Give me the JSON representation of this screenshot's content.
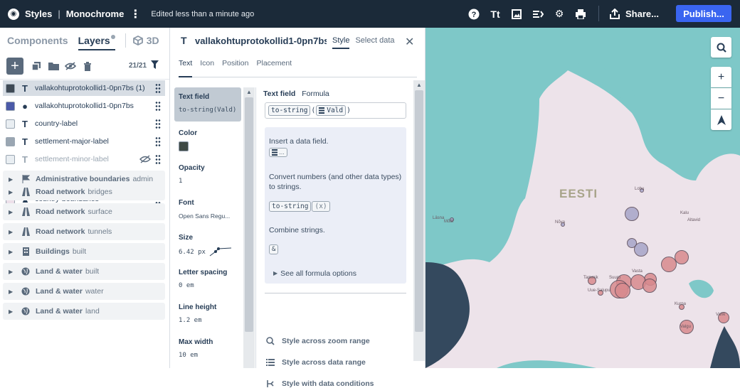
{
  "topbar": {
    "crumb_styles": "Styles",
    "crumb_style_name": "Monochrome",
    "edited": "Edited less than a minute ago",
    "share_label": "Share...",
    "publish_label": "Publish..."
  },
  "left": {
    "tab_components": "Components",
    "tab_layers": "Layers",
    "tab_3d": "3D",
    "layer_count": "21/21",
    "layers": [
      {
        "name": "vallakohtuprotokollid1-0pn7bs (1)",
        "type": "T",
        "swatch": "#3f4a55",
        "selected": true
      },
      {
        "name": "vallakohtuprotokollid1-0pn7bs",
        "type": "●",
        "swatch": "#4b5aa8"
      },
      {
        "name": "country-label",
        "type": "T",
        "swatch": "#e9eef2"
      },
      {
        "name": "settlement-major-label",
        "type": "T",
        "swatch": "#9aa6b2"
      },
      {
        "name": "settlement-minor-label",
        "type": "T",
        "swatch": "#e9eef2",
        "hidden": true
      },
      {
        "name": "country-boundaries",
        "type": "▲",
        "swatch": "#ede0ea"
      }
    ],
    "groups": [
      {
        "name": "Administrative boundaries",
        "sub": "admin",
        "icon": "flag-icon"
      },
      {
        "name": "Road network",
        "sub": "bridges",
        "icon": "road-icon"
      },
      {
        "name": "Road network",
        "sub": "surface",
        "icon": "road-icon"
      },
      {
        "name": "Road network",
        "sub": "tunnels",
        "icon": "road-icon"
      },
      {
        "name": "Buildings",
        "sub": "built",
        "icon": "building-icon"
      },
      {
        "name": "Land & water",
        "sub": "built",
        "icon": "globe-icon"
      },
      {
        "name": "Land & water",
        "sub": "water",
        "icon": "globe-icon"
      },
      {
        "name": "Land & water",
        "sub": "land",
        "icon": "globe-icon"
      }
    ]
  },
  "mid": {
    "title": "vallakohtuprotokollid1-0pn7bs (1)",
    "tab_style": "Style",
    "tab_select_data": "Select data",
    "subtabs": [
      "Text",
      "Icon",
      "Position",
      "Placement"
    ],
    "props": [
      {
        "label": "Text field",
        "value": "to-string(Vald)"
      },
      {
        "label": "Color",
        "value": ""
      },
      {
        "label": "Opacity",
        "value": "1"
      },
      {
        "label": "Font",
        "value": "Open Sans Regu..."
      },
      {
        "label": "Size",
        "value": "6.42 px"
      },
      {
        "label": "Letter spacing",
        "value": "0 em"
      },
      {
        "label": "Line height",
        "value": "1.2 em"
      },
      {
        "label": "Max width",
        "value": "10 em"
      }
    ],
    "color_value": "#3f4a45",
    "editor": {
      "header_bold": "Text field",
      "header_sub": "Formula",
      "formula_fn": "to-string",
      "formula_arg": "Vald",
      "insert_text": "Insert a data field.",
      "convert_text": "Convert numbers (and other data types) to strings.",
      "tostring_token": "to-string",
      "tostring_arg": "(x)",
      "combine_text": "Combine strings.",
      "amp_token": "&",
      "see_all": "See all formula options"
    },
    "actions": [
      {
        "label": "Style across zoom range",
        "icon": "zoom-icon"
      },
      {
        "label": "Style across data range",
        "icon": "list-icon"
      },
      {
        "label": "Style with data conditions",
        "icon": "branch-icon"
      }
    ]
  },
  "map": {
    "country_label": "EESTI",
    "place_labels": [
      "Läsna",
      "Mõdi",
      "Nõva",
      "Lohu",
      "Kalu",
      "Altavid",
      "Vasta",
      "Tammik",
      "Suuru",
      "Uue-Salupu",
      "Kurna",
      "Vahk",
      "Valgu"
    ]
  }
}
